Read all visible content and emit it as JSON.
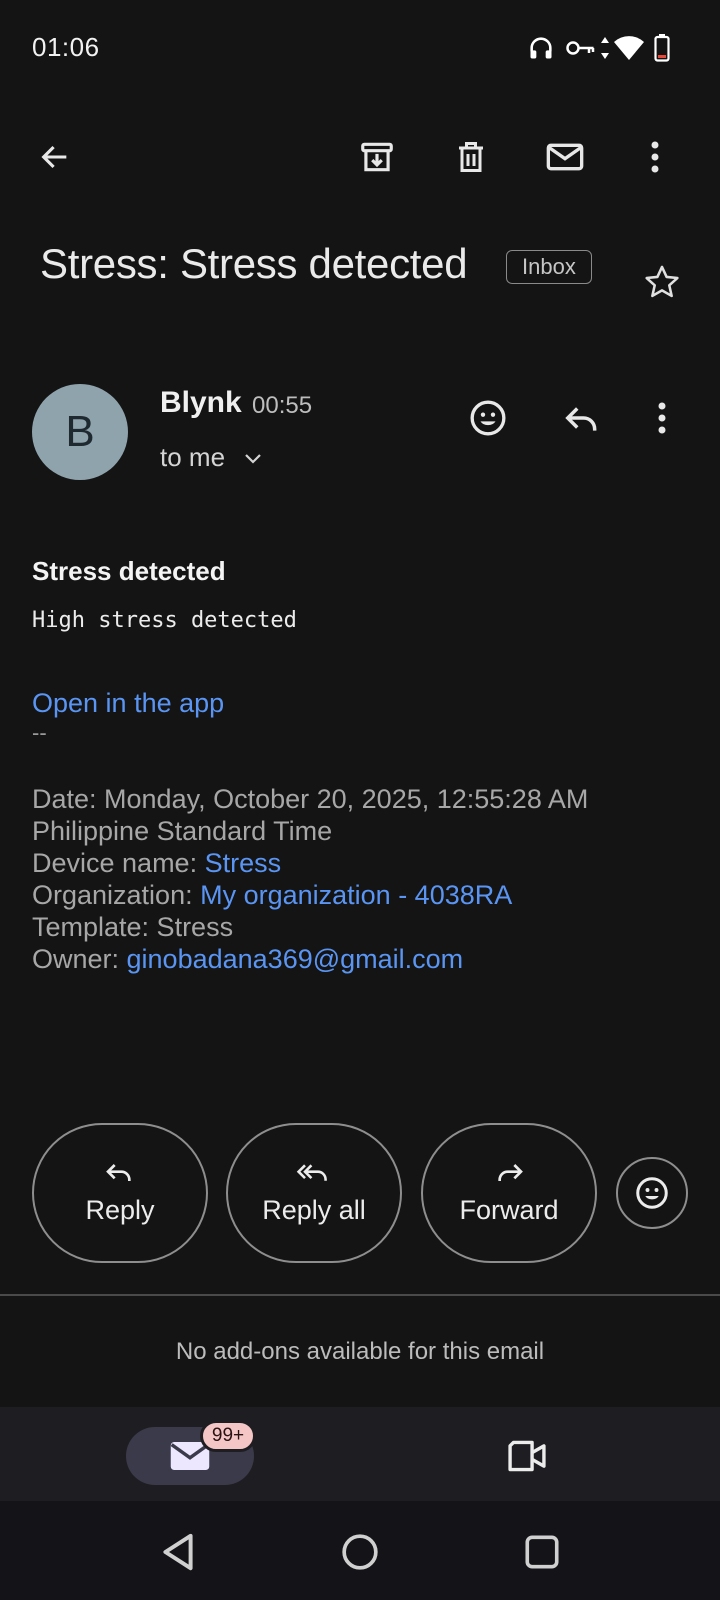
{
  "status_bar": {
    "time": "01:06"
  },
  "toolbar": {
    "back_icon": "arrow-left-icon",
    "archive_icon": "archive-icon",
    "delete_icon": "trash-icon",
    "mark_unread_icon": "mail-icon",
    "more_icon": "more-vert-icon"
  },
  "email": {
    "subject": "Stress: Stress detected",
    "label": "Inbox",
    "sender": {
      "initial": "B",
      "name": "Blynk",
      "time": "00:55",
      "recipient": "to me"
    },
    "body": {
      "heading": "Stress detected",
      "text": "High stress detected",
      "link": "Open in the app",
      "separator": "--",
      "date_line1": "Date: Monday, October 20, 2025, 12:55:28 AM",
      "date_line2": "Philippine Standard Time",
      "device_label": "Device name: ",
      "device_value": "Stress",
      "org_label": "Organization: ",
      "org_value": "My organization - 4038RA",
      "template_line": "Template: Stress",
      "owner_label": "Owner: ",
      "owner_value": "ginobadana369@gmail.com"
    }
  },
  "actions": {
    "reply": "Reply",
    "reply_all": "Reply all",
    "forward": "Forward"
  },
  "addons": "No add-ons available for this email",
  "bottom_nav": {
    "mail_badge": "99+"
  },
  "colors": {
    "background": "#141414",
    "link": "#5a95f3",
    "avatar": "#8fa3ad",
    "badge": "#f5c6c6"
  }
}
